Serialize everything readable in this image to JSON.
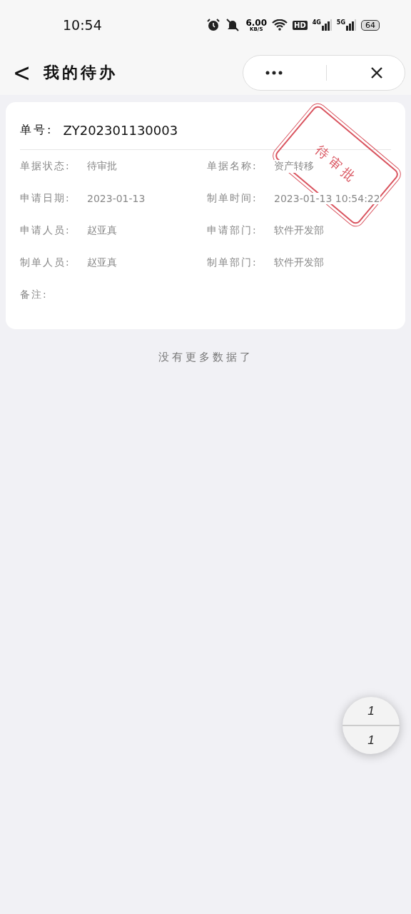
{
  "status_bar": {
    "time": "10:54",
    "net_speed": "6.00",
    "net_unit": "KB/S",
    "hd": "HD",
    "sim1": "4G",
    "sim2": "5G",
    "battery": "64"
  },
  "header": {
    "back": "<",
    "title": "我的待办"
  },
  "card": {
    "number_label": "单号:",
    "number": "ZY202301130003",
    "stamp": "待审批",
    "fields": [
      {
        "label": "单据状态:",
        "value": "待审批"
      },
      {
        "label": "单据名称:",
        "value": "资产转移"
      },
      {
        "label": "申请日期:",
        "value": "2023-01-13"
      },
      {
        "label": "制单时间:",
        "value": "2023-01-13 10:54:22"
      },
      {
        "label": "申请人员:",
        "value": "赵亚真"
      },
      {
        "label": "申请部门:",
        "value": "软件开发部"
      },
      {
        "label": "制单人员:",
        "value": "赵亚真"
      },
      {
        "label": "制单部门:",
        "value": "软件开发部"
      },
      {
        "label": "备注:"
      }
    ]
  },
  "end_message": "没有更多数据了",
  "page_indicator": {
    "current": "1",
    "total": "1"
  }
}
